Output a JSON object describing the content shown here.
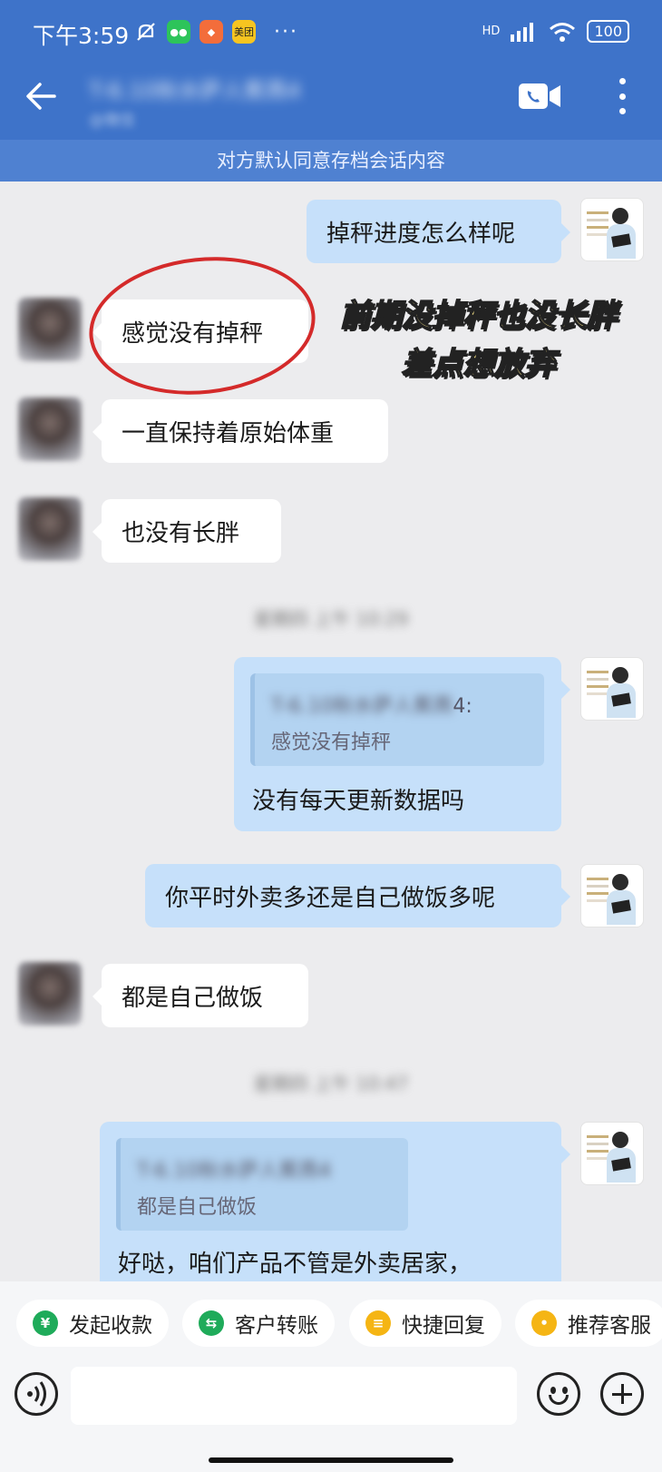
{
  "status_bar": {
    "time": "下午3:59",
    "app_icons": [
      "wechat-icon",
      "shopping-icon",
      "meituan-icon"
    ],
    "meituan_label": "美团",
    "dots": "···",
    "signal": "HD",
    "battery": "100"
  },
  "header": {
    "title": "T-6.10秋水萨人蕉燕4",
    "subtitle": "@微信"
  },
  "notice": "对方默认同意存档会话内容",
  "messages": [
    {
      "side": "right",
      "text": "掉秤进度怎么样呢"
    },
    {
      "side": "left",
      "text": "感觉没有掉秤"
    },
    {
      "side": "left",
      "text": "一直保持着原始体重"
    },
    {
      "side": "left",
      "text": "也没有长胖"
    },
    {
      "side": "right",
      "quote_name": "T-6.10秋水萨人蕉燕",
      "quote_name_suffix": "4:",
      "quote_text": "感觉没有掉秤",
      "text": "没有每天更新数据吗"
    },
    {
      "side": "right",
      "text": "你平时外卖多还是自己做饭多呢"
    },
    {
      "side": "left",
      "text": "都是自己做饭"
    },
    {
      "side": "right",
      "quote_name": "T-6.10秋水萨人蕉燕4",
      "quote_text": "都是自己做饭",
      "text": "好哒，咱们产品不管是外卖居家，"
    }
  ],
  "timestamps": [
    "星期四 上午 10:29",
    "星期四 上午 10:47"
  ],
  "annotation": {
    "line1": "前期没掉秤也没长胖",
    "line2": "差点想放弃",
    "color": "#fde88a"
  },
  "actions": [
    {
      "label": "发起收款",
      "icon": "payment-icon",
      "icon_glyph": "¥",
      "color": "#1fab5a"
    },
    {
      "label": "客户转账",
      "icon": "transfer-icon",
      "icon_glyph": "⇆",
      "color": "#1fab5a"
    },
    {
      "label": "快捷回复",
      "icon": "quick-reply-icon",
      "icon_glyph": "≡",
      "color": "#f5b514"
    },
    {
      "label": "推荐客服",
      "icon": "recommend-service-icon",
      "icon_glyph": "•",
      "color": "#f5b514"
    }
  ],
  "input": {
    "placeholder": ""
  },
  "colors": {
    "header": "#3e73c9",
    "notice": "#4f81d1",
    "bubble_self": "#c6e0fa",
    "bubble_other": "#ffffff",
    "highlight_circle": "#d42a2a"
  }
}
